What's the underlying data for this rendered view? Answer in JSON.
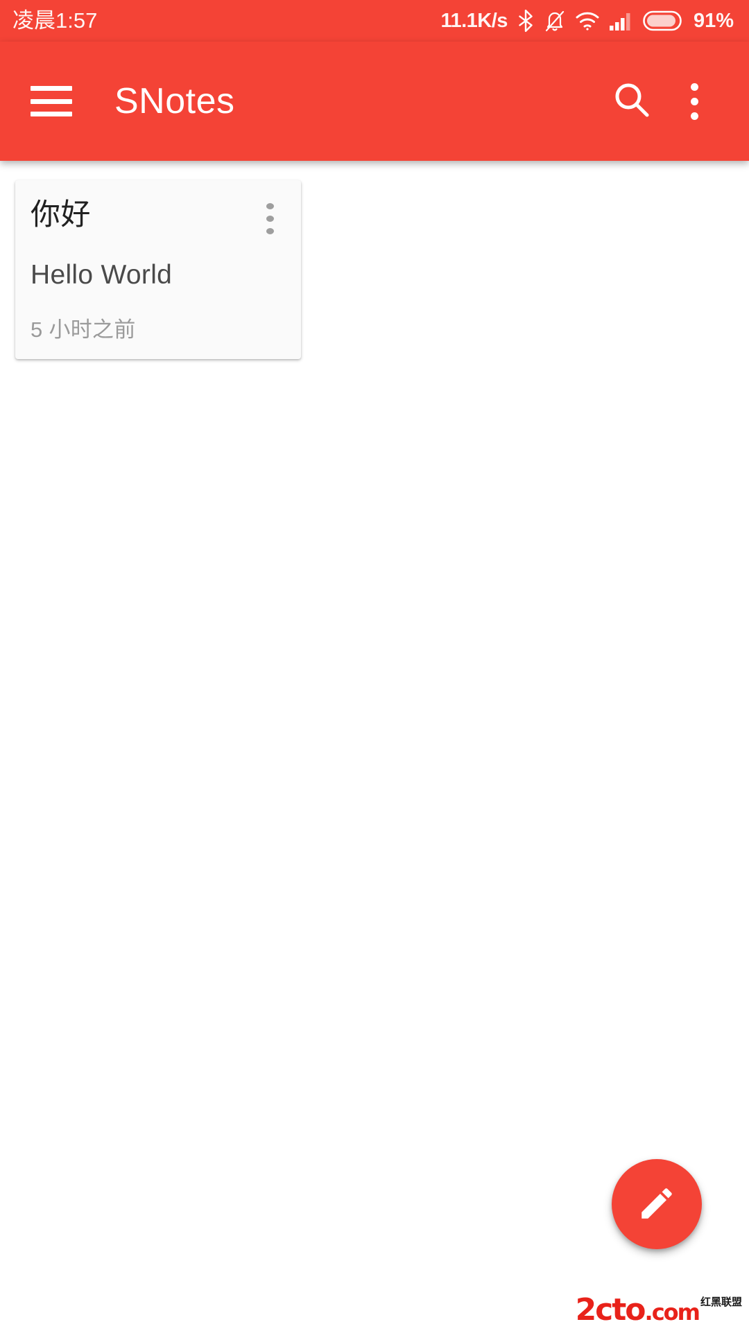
{
  "status_bar": {
    "time": "凌晨1:57",
    "network_speed": "11.1K/s",
    "battery_percent": "91%",
    "icons": [
      "bluetooth-icon",
      "notifications-off-icon",
      "wifi-icon",
      "signal-icon",
      "battery-icon"
    ],
    "background_color": "#F44336",
    "text_color": "#FFFFFF"
  },
  "app_bar": {
    "title": "SNotes",
    "menu_icon": "hamburger-menu-icon",
    "search_icon": "search-icon",
    "overflow_icon": "more-vert-icon",
    "background_color": "#F44336",
    "text_color": "#FFFFFF"
  },
  "notes": [
    {
      "title": "你好",
      "body": "Hello World",
      "time": "5 小时之前",
      "menu_icon": "more-vert-icon",
      "card_color": "#FAFAFA"
    }
  ],
  "fab": {
    "icon": "edit-pencil-icon",
    "color": "#F44336"
  },
  "watermark": {
    "brand": "2cto",
    "tld": ".com",
    "chinese": "红黑联盟",
    "brand_color": "#E8221A"
  }
}
